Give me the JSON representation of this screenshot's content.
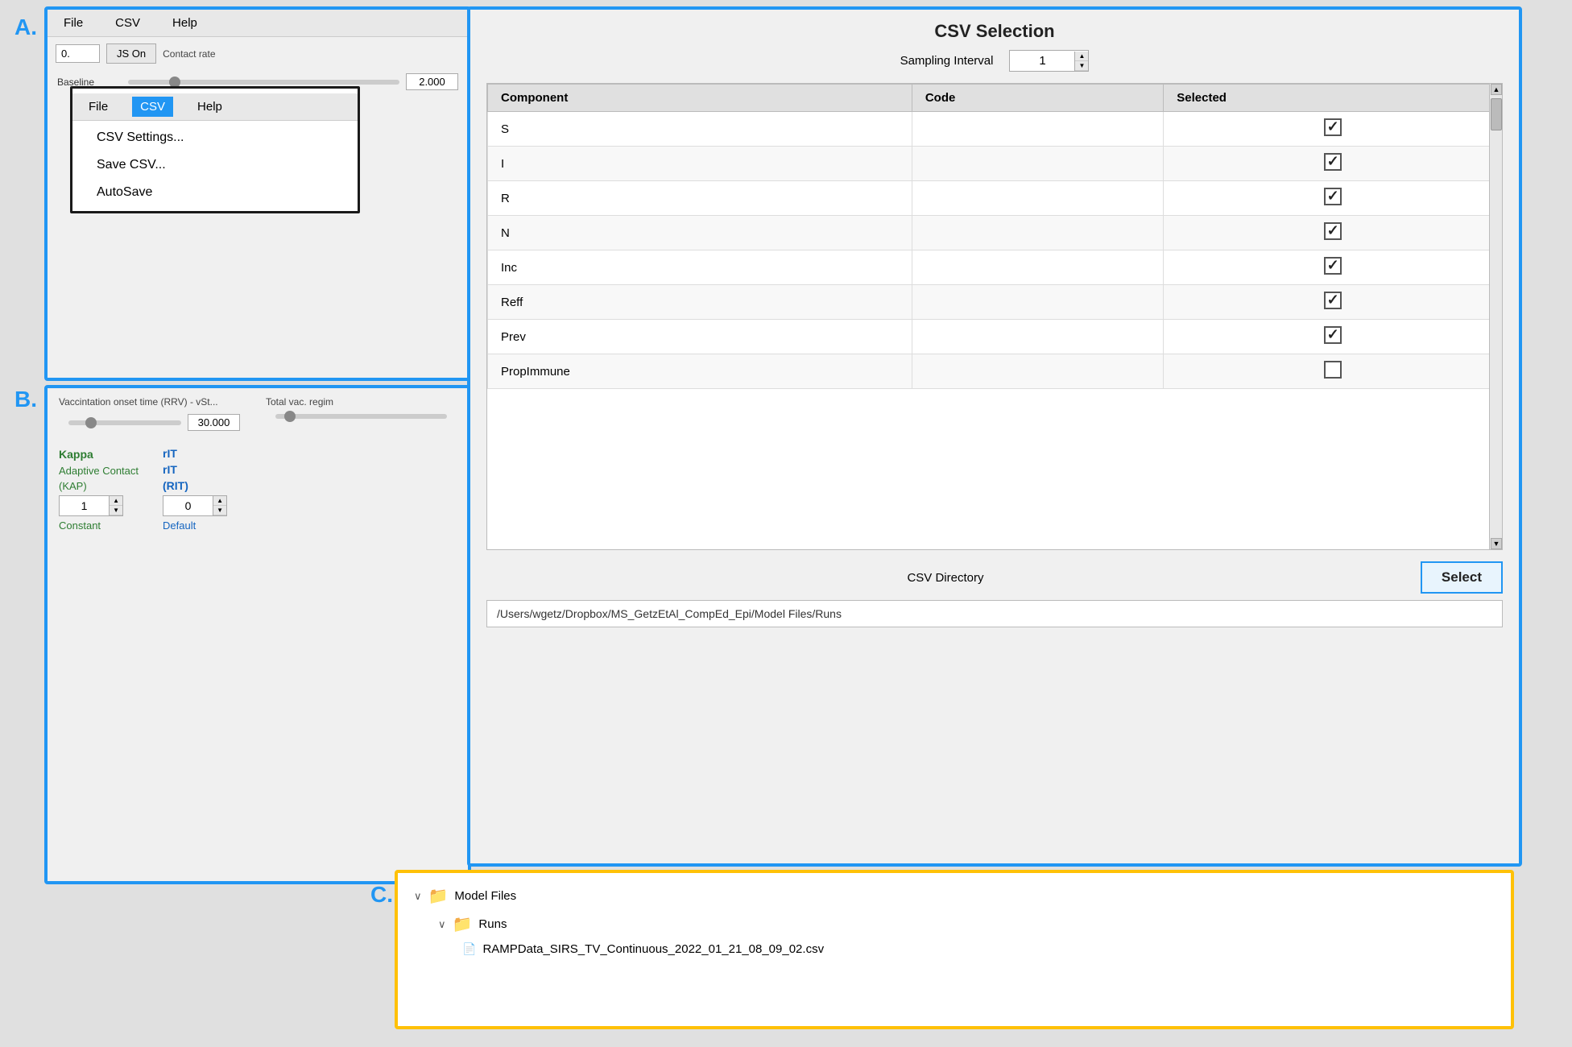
{
  "labels": {
    "a": "A.",
    "b": "B.",
    "c": "C."
  },
  "panelA": {
    "menubar": {
      "items": [
        "File",
        "CSV",
        "Help"
      ],
      "activeIndex": 1
    },
    "dropdown": {
      "header": {
        "items": [
          "File",
          "CSV",
          "Help"
        ],
        "activeIndex": 1
      },
      "items": [
        "CSV Settings...",
        "Save CSV...",
        "AutoSave"
      ]
    },
    "smallNumValue": "0.",
    "jsBtnLabel": "JS On",
    "baselineLabel": "Baseline",
    "sliderValue": "2.000",
    "contactRateLabel": "Contact rate"
  },
  "panelB": {
    "vacLabel": "Vaccintation onset time (RRV) - vSt...",
    "vacValue": "30.000",
    "totalVacLabel": "Total vac. regim",
    "kappa": {
      "title": "Kappa",
      "subtitle1": "Adaptive Contact",
      "subtitle2": "(KAP)",
      "value": "1",
      "bottomLabel": "Constant"
    },
    "rlt": {
      "title1": "rIT",
      "title2": "rIT",
      "subtitle": "(RIT)",
      "value": "0",
      "bottomLabel": "Default"
    }
  },
  "csvPanel": {
    "title": "CSV Selection",
    "samplingLabel": "Sampling Interval",
    "samplingValue": "1",
    "table": {
      "headers": [
        "Component",
        "Code",
        "Selected"
      ],
      "rows": [
        {
          "component": "S",
          "code": "",
          "selected": true
        },
        {
          "component": "I",
          "code": "",
          "selected": true
        },
        {
          "component": "R",
          "code": "",
          "selected": true
        },
        {
          "component": "N",
          "code": "",
          "selected": true
        },
        {
          "component": "Inc",
          "code": "",
          "selected": true
        },
        {
          "component": "Reff",
          "code": "",
          "selected": true
        },
        {
          "component": "Prev",
          "code": "",
          "selected": true
        },
        {
          "component": "PropImmune",
          "code": "",
          "selected": false
        }
      ]
    },
    "directoryLabel": "CSV Directory",
    "selectBtnLabel": "Select",
    "pathValue": "/Users/wgetz/Dropbox/MS_GetzEtAl_CompEd_Epi/Model Files/Runs"
  },
  "panelC": {
    "items": [
      {
        "type": "folder",
        "name": "Model Files",
        "indent": 0,
        "expanded": true
      },
      {
        "type": "folder",
        "name": "Runs",
        "indent": 1,
        "expanded": true
      },
      {
        "type": "file",
        "name": "RAMPData_SIRS_TV_Continuous_2022_01_21_08_09_02.csv",
        "indent": 2
      }
    ]
  }
}
